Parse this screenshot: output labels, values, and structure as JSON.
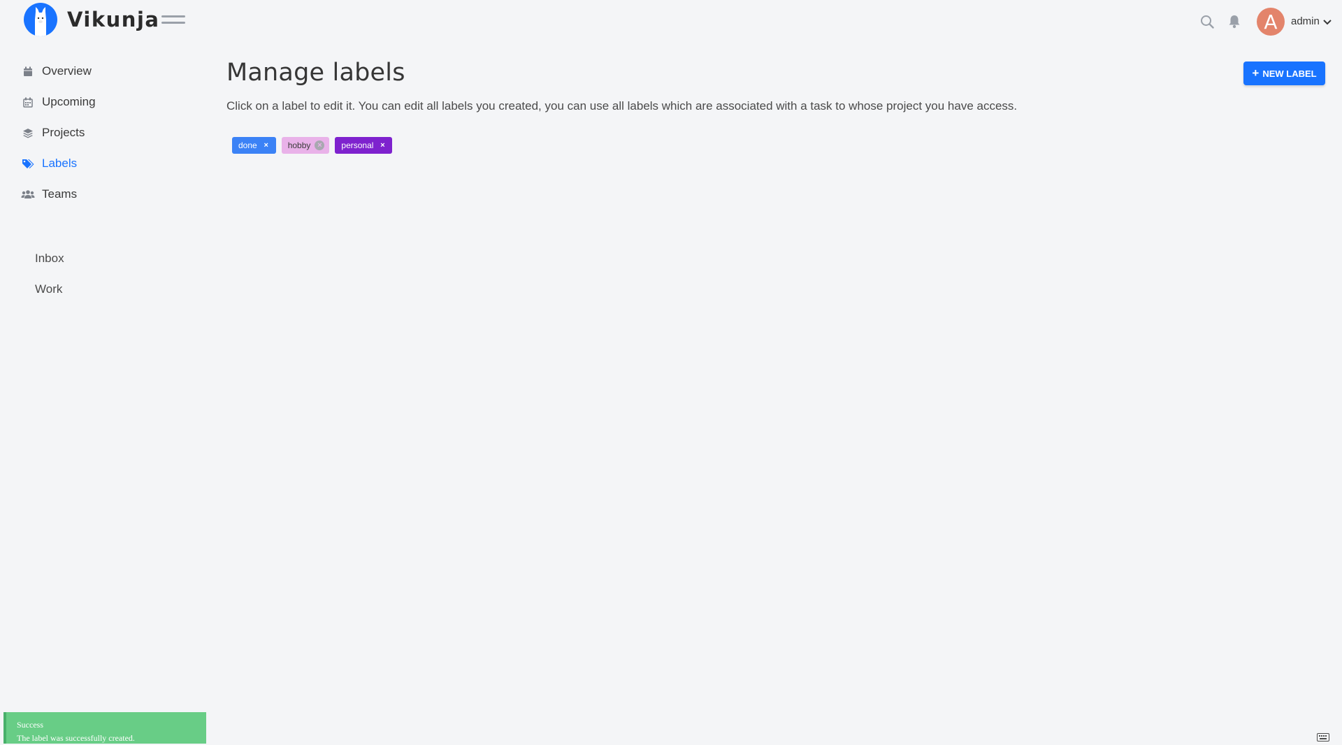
{
  "app": {
    "name": "Vikunja"
  },
  "header": {
    "username": "admin",
    "avatar_letter": "A",
    "avatar_color": "#e3846b"
  },
  "sidebar": {
    "nav": [
      {
        "label": "Overview",
        "icon": "calendar-icon"
      },
      {
        "label": "Upcoming",
        "icon": "calendar-grid-icon"
      },
      {
        "label": "Projects",
        "icon": "layers-icon"
      },
      {
        "label": "Labels",
        "icon": "tags-icon",
        "active": true
      },
      {
        "label": "Teams",
        "icon": "users-icon"
      }
    ],
    "projects": [
      {
        "label": "Inbox"
      },
      {
        "label": "Work"
      }
    ]
  },
  "main": {
    "title": "Manage labels",
    "description": "Click on a label to edit it. You can edit all labels you created, you can use all labels which are associated with a task to whose project you have access.",
    "new_label_button": "NEW LABEL",
    "labels": [
      {
        "name": "done",
        "bg": "#3b82f6",
        "fg": "#ffffff"
      },
      {
        "name": "hobby",
        "bg": "#e9b2e9",
        "fg": "#3a3a3a"
      },
      {
        "name": "personal",
        "bg": "#7e22ce",
        "fg": "#ffffff"
      }
    ]
  },
  "toast": {
    "title": "Success",
    "message": "The label was successfully created.",
    "color": "#68cd86"
  },
  "colors": {
    "accent": "#1973ff",
    "background": "#f4f5f7"
  }
}
